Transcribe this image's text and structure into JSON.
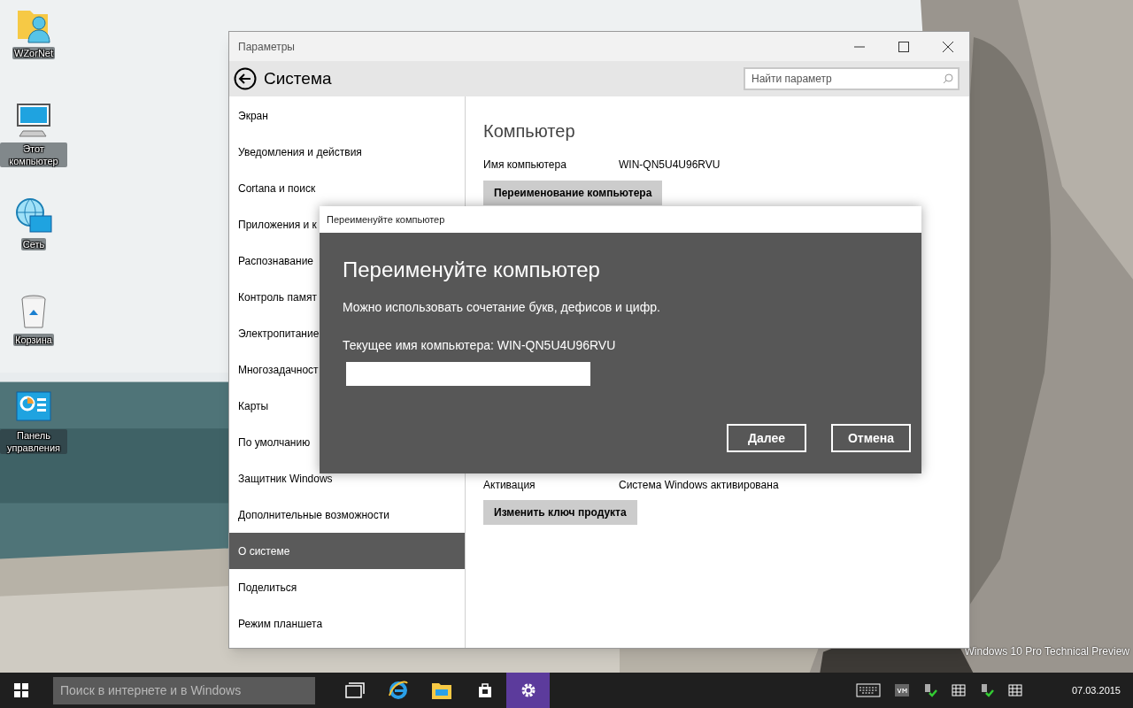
{
  "desktop_icons": [
    {
      "label": "WZorNet",
      "kind": "user-folder"
    },
    {
      "label": "Этот компьютер",
      "kind": "computer"
    },
    {
      "label": "Сеть",
      "kind": "network"
    },
    {
      "label": "Корзина",
      "kind": "bin"
    },
    {
      "label": "Панель управления",
      "kind": "control-panel"
    }
  ],
  "window": {
    "title": "Параметры",
    "header": "Система",
    "search": {
      "placeholder": "Найти параметр"
    },
    "sidebar": {
      "items": [
        {
          "label": "Экран",
          "selected": false
        },
        {
          "label": "Уведомления и действия",
          "selected": false
        },
        {
          "label": "Cortana и поиск",
          "selected": false
        },
        {
          "label": "Приложения и к",
          "selected": false
        },
        {
          "label": "Распознавание",
          "selected": false
        },
        {
          "label": "Контроль памят",
          "selected": false
        },
        {
          "label": "Электропитание",
          "selected": false
        },
        {
          "label": "Многозадачност",
          "selected": false
        },
        {
          "label": "Карты",
          "selected": false
        },
        {
          "label": "По умолчанию",
          "selected": false
        },
        {
          "label": "Защитник Windows",
          "selected": false
        },
        {
          "label": "Дополнительные возможности",
          "selected": false
        },
        {
          "label": "О системе",
          "selected": true
        },
        {
          "label": "Поделиться",
          "selected": false
        },
        {
          "label": "Режим планшета",
          "selected": false
        }
      ]
    },
    "content": {
      "heading": "Компьютер",
      "name_label": "Имя компьютера",
      "name_value": "WIN-QN5U4U96RVU",
      "rename_button": "Переименование компьютера",
      "activation_label": "Активация",
      "activation_value": "Система Windows активирована",
      "key_button": "Изменить ключ продукта"
    }
  },
  "dialog": {
    "title": "Переименуйте компьютер",
    "heading": "Переименуйте компьютер",
    "hint": "Можно использовать сочетание букв, дефисов и цифр.",
    "current": "Текущее имя компьютера: WIN-QN5U4U96RVU",
    "buttons": [
      "Далее",
      "Отмена"
    ]
  },
  "watermark_text": "Windows 10 Pro Technical Preview",
  "taskbar": {
    "search": {
      "placeholder": "Поиск в интернете и в Windows"
    },
    "apps": [
      {
        "kind": "task-view",
        "selected": false
      },
      {
        "kind": "browser",
        "selected": false
      },
      {
        "kind": "folder",
        "selected": false
      },
      {
        "kind": "store",
        "selected": false
      },
      {
        "kind": "settings",
        "selected": true
      }
    ],
    "tray": [
      {
        "kind": "keyboard"
      },
      {
        "kind": "vm"
      },
      {
        "kind": "flag"
      },
      {
        "kind": "grid"
      },
      {
        "kind": "flag"
      },
      {
        "kind": "grid"
      }
    ],
    "date": "07.03.2015"
  }
}
